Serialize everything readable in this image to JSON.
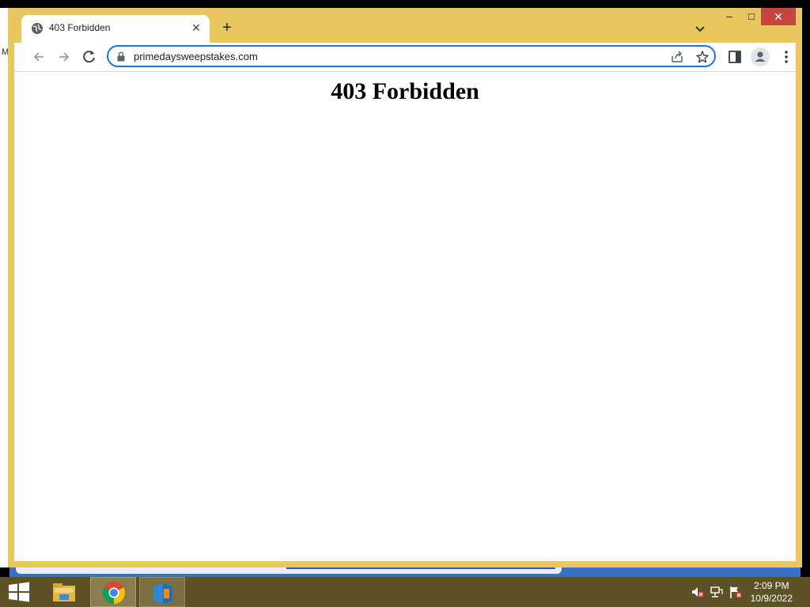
{
  "desktop": {
    "edge_text": "M"
  },
  "browser": {
    "tab": {
      "title": "403 Forbidden",
      "favicon": "globe-icon"
    },
    "window_controls": {
      "minimize": "–",
      "maximize": "□",
      "close": "✕"
    },
    "address_bar": {
      "url": "primedaysweepstakes.com"
    }
  },
  "page": {
    "heading": "403 Forbidden"
  },
  "taskbar": {
    "pinned": [
      "file-explorer-icon",
      "chrome-icon",
      "app-icon"
    ],
    "clock": {
      "time": "2:09 PM",
      "date": "10/9/2022"
    }
  },
  "colors": {
    "window_frame": "#e8c85e",
    "taskbar": "#5c5127",
    "focus_ring": "#1a73e8",
    "close_button": "#c7453f"
  }
}
